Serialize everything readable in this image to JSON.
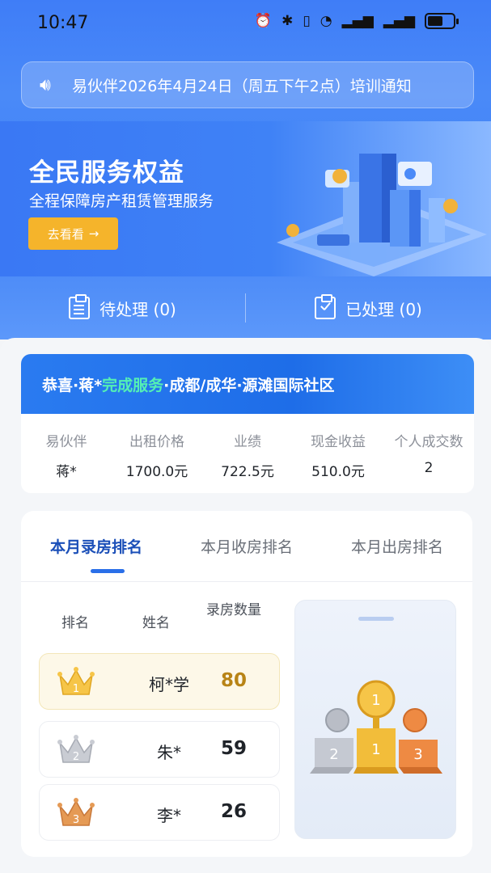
{
  "status": {
    "time": "10:47"
  },
  "notice": {
    "text": "易伙伴2026年4月24日（周五下午2点）培训通知"
  },
  "banner": {
    "title": "全民服务权益",
    "subtitle": "全程保障房产租赁管理服务",
    "button": "去看看"
  },
  "tasks": {
    "pending": "待处理 (0)",
    "done": "已处理 (0)"
  },
  "congrats": {
    "prefix": "恭喜·蒋*",
    "highlight": "完成服务",
    "suffix": "·成都/成华·源滩国际社区"
  },
  "stats": [
    {
      "label": "易伙伴",
      "value": "蒋*"
    },
    {
      "label": "出租价格",
      "value": "1700.0元"
    },
    {
      "label": "业绩",
      "value": "722.5元"
    },
    {
      "label": "现金收益",
      "value": "510.0元"
    },
    {
      "label": "个人成交数",
      "value": "2"
    }
  ],
  "ranking": {
    "tabs": [
      "本月录房排名",
      "本月收房排名",
      "本月出房排名"
    ],
    "headers": {
      "rank": "排名",
      "name": "姓名",
      "count": "录房数量"
    },
    "rows": [
      {
        "rank": "1",
        "name": "柯*学",
        "count": "80"
      },
      {
        "rank": "2",
        "name": "朱*",
        "count": "59"
      },
      {
        "rank": "3",
        "name": "李*",
        "count": "26"
      }
    ]
  },
  "colors": {
    "primary": "#3f7df7",
    "accent": "#f5b42b",
    "highlight": "#54f0b4",
    "gold": "#b88416"
  }
}
